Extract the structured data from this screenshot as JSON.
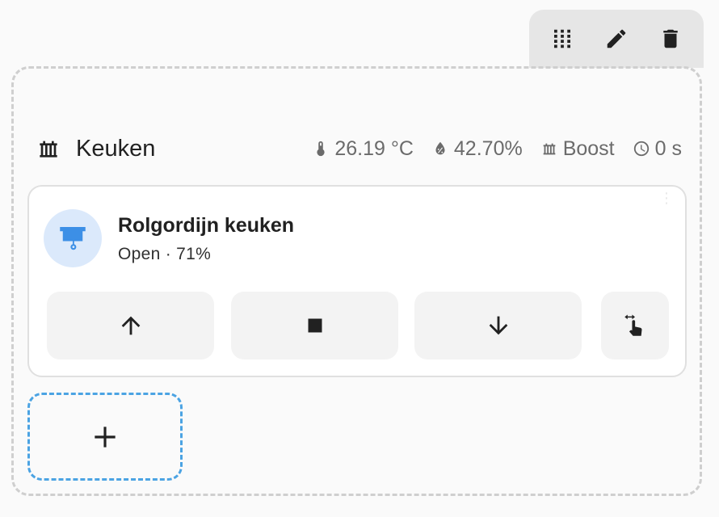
{
  "toolbar": {
    "icons": [
      "drag-grid-icon",
      "pencil-icon",
      "trash-icon"
    ]
  },
  "area": {
    "icon": "radiator-icon",
    "name": "Keuken",
    "badges": [
      {
        "icon": "thermometer-icon",
        "text": "26.19 °C"
      },
      {
        "icon": "water-percent-icon",
        "text": "42.70%"
      },
      {
        "icon": "radiator-icon",
        "text": "Boost"
      },
      {
        "icon": "clock-icon",
        "text": "0 s"
      }
    ]
  },
  "card": {
    "entity_icon": "roller-blind-icon",
    "name": "Rolgordijn keuken",
    "state": "Open · 71%",
    "position_percent": 71,
    "controls": [
      "arrow-up-icon",
      "stop-icon",
      "arrow-down-icon",
      "position-gesture-icon"
    ]
  },
  "add_card": {
    "icon": "plus-icon"
  },
  "colors": {
    "accent": "#4ba3e3",
    "entity_icon": "#3c8fe6",
    "entity_icon_bg": "#dbe9fb",
    "badge_text": "#6b6b6b"
  }
}
